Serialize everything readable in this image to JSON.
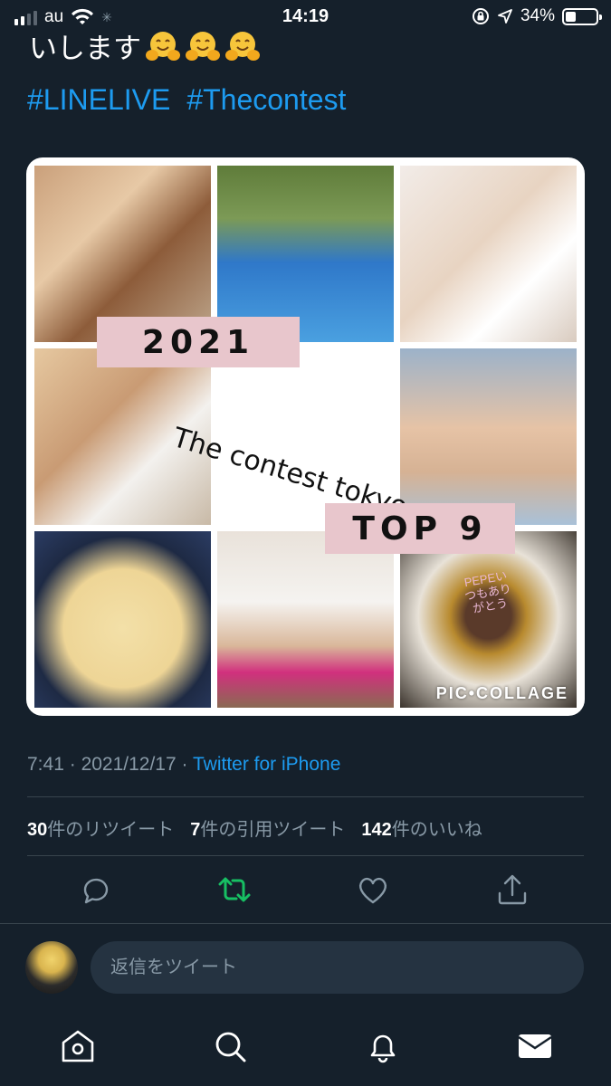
{
  "status_bar": {
    "carrier": "au",
    "time": "14:19",
    "battery_percent": "34%",
    "battery_level": 0.34,
    "signal_bars": 2
  },
  "tweet": {
    "text_tail": "いします",
    "emoji": "hugging-face",
    "hashtags": [
      "#LINELIVE",
      "#Thecontest"
    ]
  },
  "image": {
    "tape_year": "2021",
    "overlay_text": "The contest tokyo",
    "tape_rank": "TOP 9",
    "watermark": "PIC•COLLAGE",
    "cake_message": "PEPEいつもありがとう"
  },
  "meta": {
    "time": "7:41",
    "date": "2021/12/17",
    "separator": "·",
    "source": "Twitter for iPhone"
  },
  "stats": {
    "retweets_count": "30",
    "retweets_label": "件のリツイート",
    "quotes_count": "7",
    "quotes_label": "件の引用ツイート",
    "likes_count": "142",
    "likes_label": "件のいいね"
  },
  "actions": {
    "reply_icon": "reply-icon",
    "retweet_icon": "retweet-icon",
    "like_icon": "heart-icon",
    "share_icon": "share-icon",
    "retweet_color": "#17bf63"
  },
  "reply": {
    "placeholder": "返信をツイート"
  },
  "tab_bar": {
    "items": [
      "home-icon",
      "search-icon",
      "notifications-icon",
      "messages-icon"
    ]
  },
  "colors": {
    "background": "#15202b",
    "accent": "#1d9bf0",
    "muted": "#8899a6"
  }
}
